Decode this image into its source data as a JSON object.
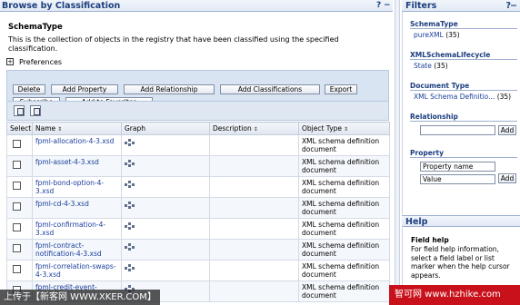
{
  "main": {
    "title": "Browse by Classification",
    "title_controls": [
      "?",
      "−",
      "□"
    ],
    "heading": "SchemaType",
    "description": "This is the collection of objects in the registry that have been classified using the specified classification.",
    "preferences_label": "Preferences",
    "buttons": {
      "delete": "Delete",
      "add_property": "Add Property",
      "add_relationship": "Add Relationship",
      "add_classifications": "Add Classifications",
      "export": "Export",
      "subscribe": "Subscribe",
      "add_to_favorites": "Add to Favorites"
    },
    "table": {
      "headers": [
        "Select",
        "Name",
        "Graph",
        "Description",
        "Object Type"
      ],
      "rows": [
        {
          "name": "fpml-allocation-4-3.xsd",
          "description": "",
          "type": "XML schema definition document"
        },
        {
          "name": "fpml-asset-4-3.xsd",
          "description": "",
          "type": "XML schema definition document"
        },
        {
          "name": "fpml-bond-option-4-3.xsd",
          "description": "",
          "type": "XML schema definition document"
        },
        {
          "name": "fpml-cd-4-3.xsd",
          "description": "",
          "type": "XML schema definition document"
        },
        {
          "name": "fpml-confirmation-4-3.xsd",
          "description": "",
          "type": "XML schema definition document"
        },
        {
          "name": "fpml-contract-notification-4-3.xsd",
          "description": "",
          "type": "XML schema definition document"
        },
        {
          "name": "fpml-correlation-swaps-4-3.xsd",
          "description": "",
          "type": "XML schema definition document"
        },
        {
          "name": "fpml-credit-event-",
          "description": "",
          "type": "XML schema definition document"
        }
      ]
    }
  },
  "filters": {
    "title": "Filters",
    "title_controls": [
      "?",
      "−"
    ],
    "sections": [
      {
        "label": "SchemaType",
        "item": "pureXML",
        "count": "(35)"
      },
      {
        "label": "XMLSchemaLifecycle",
        "item": "State",
        "count": "(35)"
      },
      {
        "label": "Document Type",
        "item": "XML Schema Definitio...",
        "count": "(35)"
      }
    ],
    "relationship_label": "Relationship",
    "relationship_add": "Add",
    "property_label": "Property",
    "property_name_value": "Property name",
    "property_value_value": "Value",
    "property_add": "Add"
  },
  "help": {
    "title": "Help",
    "heading": "Field help",
    "text": "For field help information, select a field label or list marker when the help cursor appears."
  },
  "watermarks": {
    "left": "上传于【新客网 WWW.XKER.COM】",
    "right": "智可网 www.hzhike.com"
  }
}
